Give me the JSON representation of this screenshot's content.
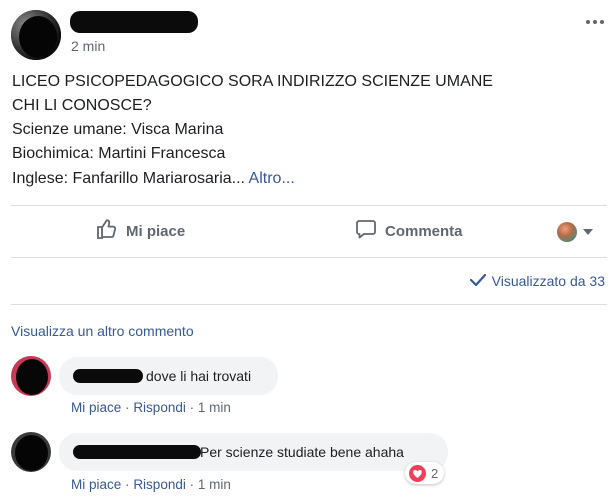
{
  "post": {
    "timestamp": "2 min",
    "lines": [
      "LICEO PSICOPEDAGOGICO SORA INDIRIZZO SCIENZE UMANE",
      "CHI LI CONOSCE?",
      "Scienze umane: Visca Marina",
      "Biochimica: Martini Francesca",
      "Inglese: Fanfarillo Mariarosaria..."
    ],
    "more_link": "Altro...",
    "more_menu_icon": "ellipsis-icon"
  },
  "actions": {
    "like_label": "Mi piace",
    "comment_label": "Comment­a"
  },
  "seen": {
    "label": "Visualizzato da 33"
  },
  "comments": {
    "view_more": "Visualizza un altro commento",
    "items": [
      {
        "text": "dove li hai trovati",
        "like": "Mi piace",
        "reply": "Rispondi",
        "sep": "·",
        "time": "1 min",
        "reactions": ""
      },
      {
        "text": "Per scienze studiate bene ahaha",
        "like": "Mi piace",
        "reply": "Rispondi",
        "sep": "·",
        "time": "1 min",
        "reactions": "2"
      }
    ]
  },
  "colors": {
    "link": "#385898",
    "muted": "#606770",
    "bubble": "#f2f3f5",
    "love": "#f33e58"
  }
}
